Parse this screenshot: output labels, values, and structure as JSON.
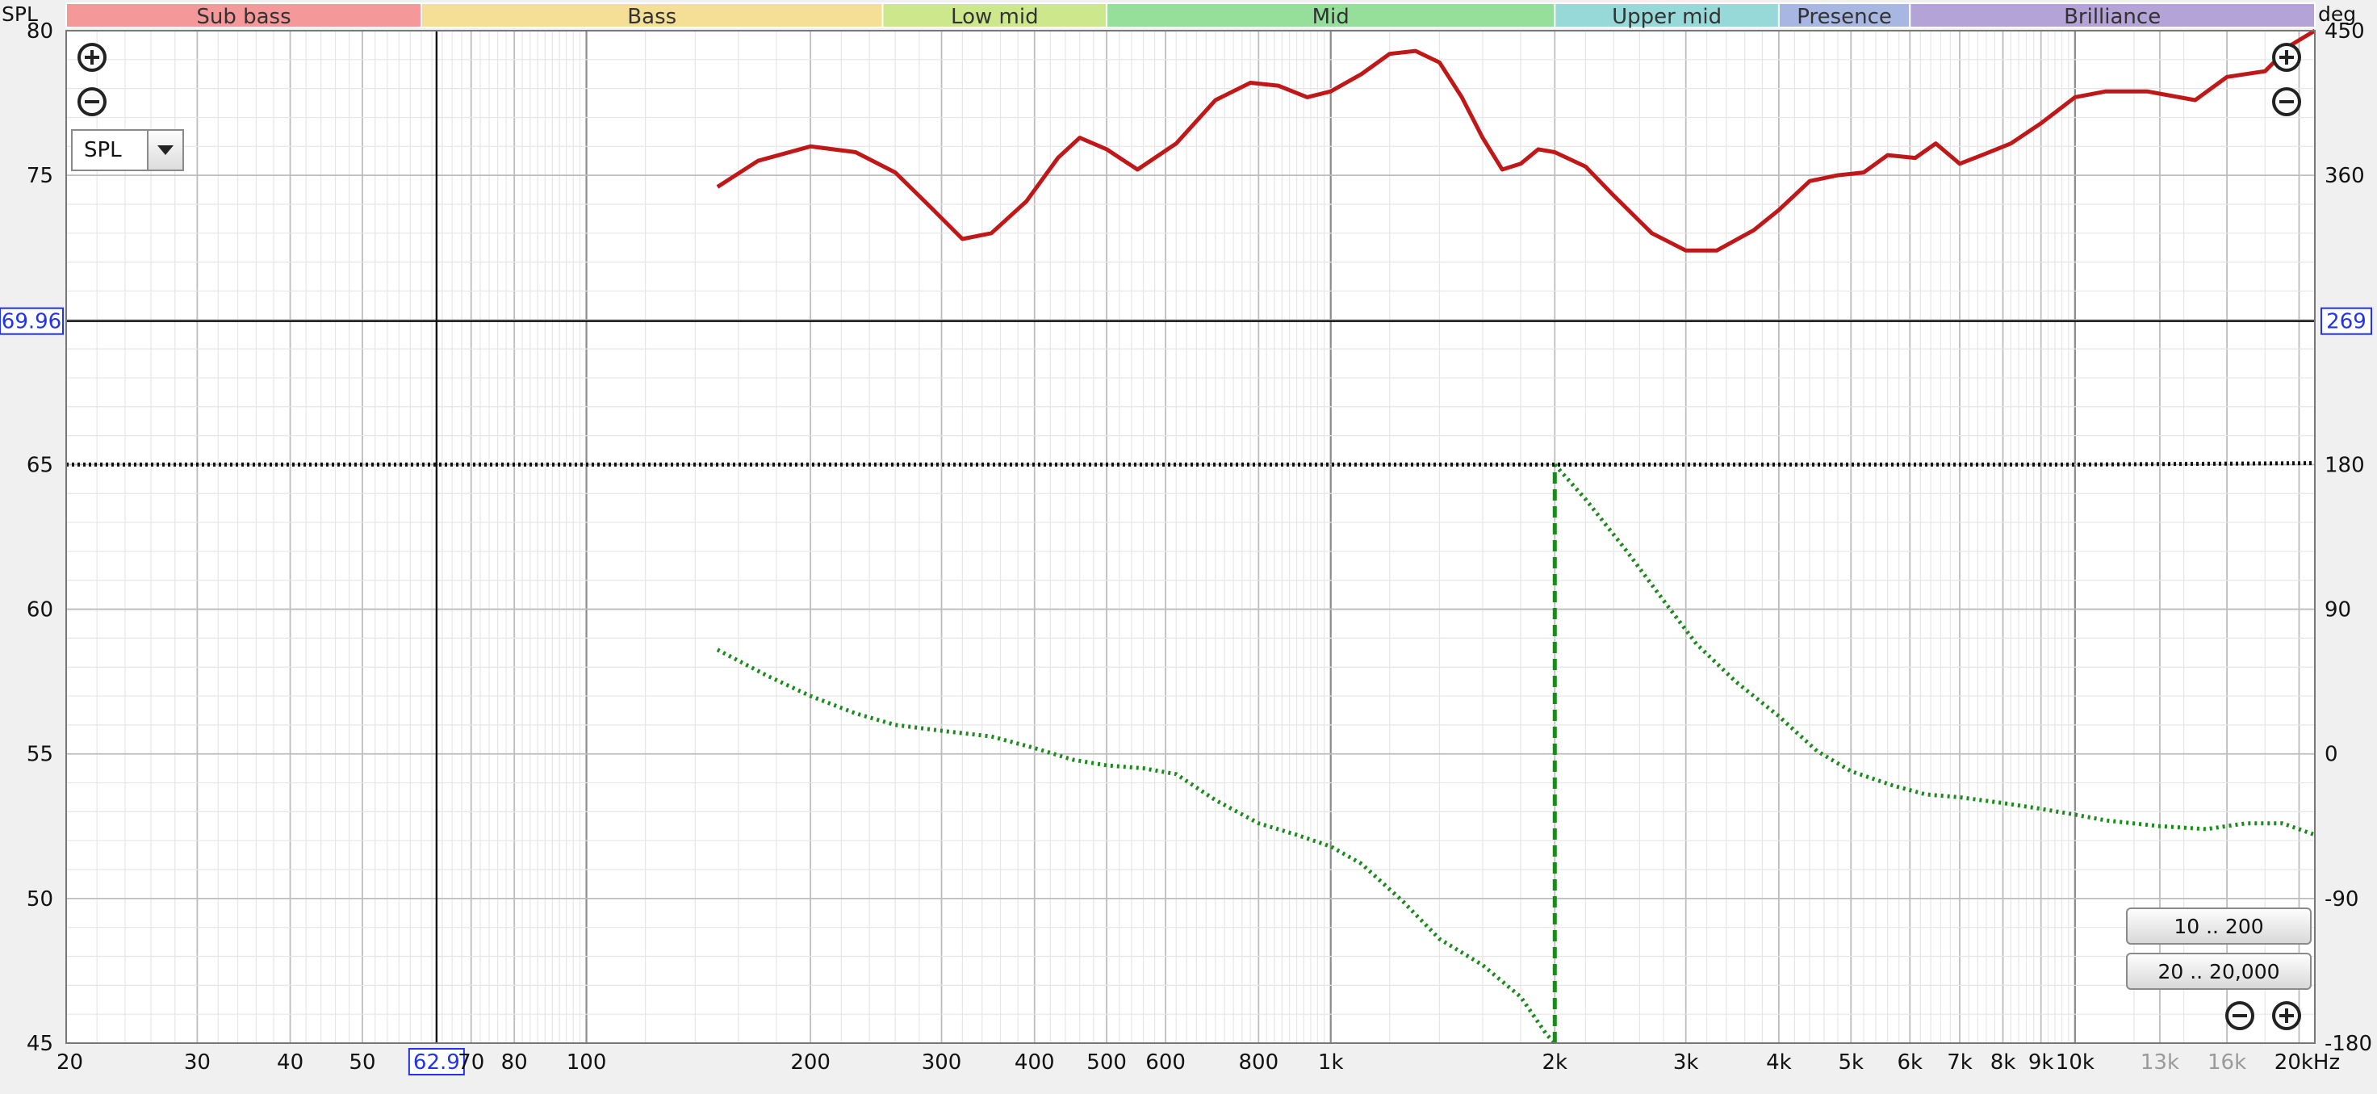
{
  "chart_data": {
    "type": "line",
    "left_axis_label": "SPL",
    "right_axis_label": "deg",
    "x_scale": "log",
    "xlim": [
      20,
      21000
    ],
    "ylim_left": [
      45,
      80
    ],
    "ylim_right": [
      -180,
      450
    ],
    "y_ticks_left": [
      "80",
      "75",
      "65",
      "60",
      "55",
      "50",
      "45"
    ],
    "y_ticks_right": [
      "450",
      "360",
      "180",
      "90",
      "0",
      "-90",
      "-180"
    ],
    "x_ticks": [
      {
        "v": 20,
        "label": "20"
      },
      {
        "v": 30,
        "label": "30"
      },
      {
        "v": 40,
        "label": "40"
      },
      {
        "v": 50,
        "label": "50"
      },
      {
        "v": 70,
        "label": "70"
      },
      {
        "v": 80,
        "label": "80"
      },
      {
        "v": 100,
        "label": "100"
      },
      {
        "v": 200,
        "label": "200"
      },
      {
        "v": 300,
        "label": "300"
      },
      {
        "v": 400,
        "label": "400"
      },
      {
        "v": 500,
        "label": "500"
      },
      {
        "v": 600,
        "label": "600"
      },
      {
        "v": 800,
        "label": "800"
      },
      {
        "v": 1000,
        "label": "1k"
      },
      {
        "v": 2000,
        "label": "2k"
      },
      {
        "v": 3000,
        "label": "3k"
      },
      {
        "v": 4000,
        "label": "4k"
      },
      {
        "v": 5000,
        "label": "5k"
      },
      {
        "v": 6000,
        "label": "6k"
      },
      {
        "v": 7000,
        "label": "7k"
      },
      {
        "v": 8000,
        "label": "8k"
      },
      {
        "v": 9000,
        "label": "9k"
      },
      {
        "v": 10000,
        "label": "10k"
      },
      {
        "v": 13000,
        "label": "13k",
        "dim": true
      },
      {
        "v": 16000,
        "label": "16k",
        "dim": true
      },
      {
        "v": 20000,
        "label": "20kHz"
      }
    ],
    "bands": [
      {
        "label": "Sub bass",
        "from": 20,
        "to": 60,
        "color": "#f4989a"
      },
      {
        "label": "Bass",
        "from": 60,
        "to": 250,
        "color": "#f5df96"
      },
      {
        "label": "Low mid",
        "from": 250,
        "to": 500,
        "color": "#cde88c"
      },
      {
        "label": "Mid",
        "from": 500,
        "to": 2000,
        "color": "#95df9b"
      },
      {
        "label": "Upper mid",
        "from": 2000,
        "to": 4000,
        "color": "#96d9d8"
      },
      {
        "label": "Presence",
        "from": 4000,
        "to": 6000,
        "color": "#a8b7e2"
      },
      {
        "label": "Brilliance",
        "from": 6000,
        "to": 21000,
        "color": "#b3a3d6"
      }
    ],
    "cursor": {
      "x": 62.9,
      "x_label": "62.9",
      "y_left": 69.96,
      "y_left_label": "69.96",
      "y_right_label": "269"
    },
    "series": [
      {
        "axis": "left",
        "style": "solid",
        "color": "#c01818",
        "points": [
          [
            150,
            74.6
          ],
          [
            170,
            75.5
          ],
          [
            200,
            76.0
          ],
          [
            230,
            75.8
          ],
          [
            260,
            75.1
          ],
          [
            290,
            73.9
          ],
          [
            320,
            72.8
          ],
          [
            350,
            73.0
          ],
          [
            390,
            74.1
          ],
          [
            430,
            75.6
          ],
          [
            460,
            76.3
          ],
          [
            500,
            75.9
          ],
          [
            550,
            75.2
          ],
          [
            620,
            76.1
          ],
          [
            700,
            77.6
          ],
          [
            780,
            78.2
          ],
          [
            850,
            78.1
          ],
          [
            930,
            77.7
          ],
          [
            1000,
            77.9
          ],
          [
            1100,
            78.5
          ],
          [
            1200,
            79.2
          ],
          [
            1300,
            79.3
          ],
          [
            1400,
            78.9
          ],
          [
            1500,
            77.7
          ],
          [
            1600,
            76.3
          ],
          [
            1700,
            75.2
          ],
          [
            1800,
            75.4
          ],
          [
            1900,
            75.9
          ],
          [
            2000,
            75.8
          ],
          [
            2200,
            75.3
          ],
          [
            2400,
            74.3
          ],
          [
            2700,
            73.0
          ],
          [
            3000,
            72.4
          ],
          [
            3300,
            72.4
          ],
          [
            3700,
            73.1
          ],
          [
            4000,
            73.8
          ],
          [
            4400,
            74.8
          ],
          [
            4800,
            75.0
          ],
          [
            5200,
            75.1
          ],
          [
            5600,
            75.7
          ],
          [
            6100,
            75.6
          ],
          [
            6500,
            76.1
          ],
          [
            7000,
            75.4
          ],
          [
            7500,
            75.7
          ],
          [
            8200,
            76.1
          ],
          [
            9000,
            76.8
          ],
          [
            10000,
            77.7
          ],
          [
            11000,
            77.9
          ],
          [
            12500,
            77.9
          ],
          [
            14500,
            77.6
          ],
          [
            16000,
            78.4
          ],
          [
            18000,
            78.6
          ],
          [
            19500,
            79.5
          ],
          [
            21000,
            80.0
          ]
        ]
      },
      {
        "axis": "right",
        "style": "dotted",
        "color": "#1a8a1a",
        "points": [
          [
            150,
            58.6
          ],
          [
            175,
            57.7
          ],
          [
            200,
            57.0
          ],
          [
            230,
            56.4
          ],
          [
            260,
            56.0
          ],
          [
            300,
            55.8
          ],
          [
            350,
            55.6
          ],
          [
            400,
            55.2
          ],
          [
            450,
            54.8
          ],
          [
            500,
            54.6
          ],
          [
            560,
            54.5
          ],
          [
            620,
            54.3
          ],
          [
            700,
            53.4
          ],
          [
            800,
            52.6
          ],
          [
            900,
            52.2
          ],
          [
            1000,
            51.8
          ],
          [
            1100,
            51.2
          ],
          [
            1250,
            49.9
          ],
          [
            1400,
            48.6
          ],
          [
            1600,
            47.7
          ],
          [
            1800,
            46.6
          ],
          [
            1950,
            45.3
          ],
          [
            2000,
            45.0
          ]
        ]
      },
      {
        "axis": "right",
        "style": "dotted",
        "color": "#1a8a1a",
        "points": [
          [
            2000,
            65.0
          ],
          [
            2200,
            63.8
          ],
          [
            2500,
            62.0
          ],
          [
            2800,
            60.3
          ],
          [
            3100,
            58.8
          ],
          [
            3500,
            57.5
          ],
          [
            4000,
            56.3
          ],
          [
            4500,
            55.1
          ],
          [
            5000,
            54.4
          ],
          [
            5700,
            53.9
          ],
          [
            6300,
            53.6
          ],
          [
            7000,
            53.5
          ],
          [
            8000,
            53.3
          ],
          [
            9000,
            53.1
          ],
          [
            10000,
            52.9
          ],
          [
            11000,
            52.7
          ],
          [
            13000,
            52.5
          ],
          [
            15000,
            52.4
          ],
          [
            17000,
            52.6
          ],
          [
            19000,
            52.6
          ],
          [
            21000,
            52.2
          ]
        ]
      },
      {
        "axis": "right",
        "style": "dashed",
        "color": "#1a8a1a",
        "points": [
          [
            2000,
            45.0
          ],
          [
            2000,
            65.0
          ]
        ]
      },
      {
        "axis": "left",
        "style": "dense-dotted",
        "color": "#111111",
        "points": [
          [
            20,
            65.0
          ],
          [
            10000,
            65.0
          ],
          [
            21000,
            65.05
          ]
        ]
      }
    ]
  },
  "controls": {
    "spl_dropdown_value": "SPL",
    "range_button_1": "10 .. 200",
    "range_button_2": "20 .. 20,000"
  }
}
